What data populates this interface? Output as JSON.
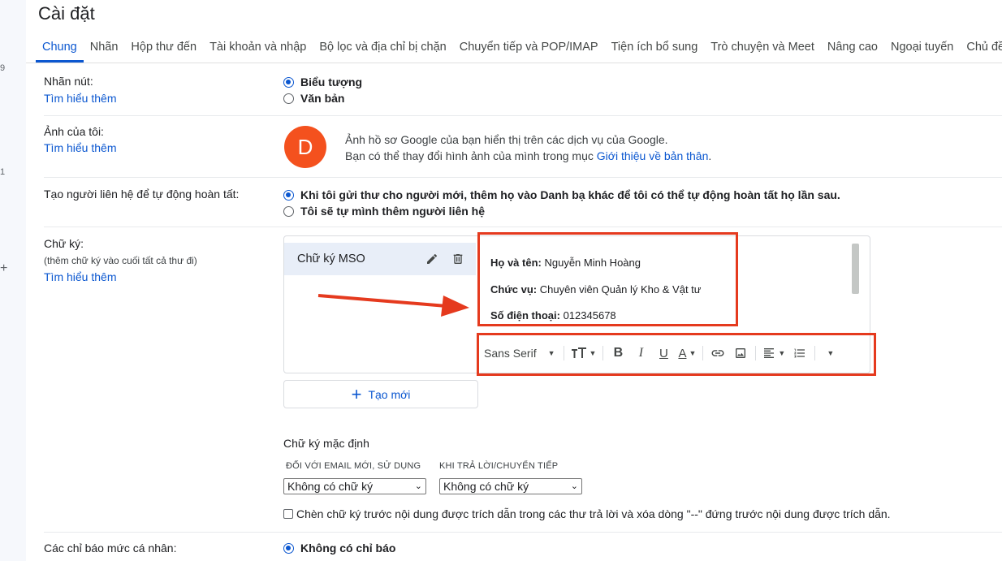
{
  "left_rail": {
    "marks": [
      "9",
      "1",
      "+"
    ]
  },
  "title": "Cài đặt",
  "tabs": [
    {
      "label": "Chung",
      "active": true
    },
    {
      "label": "Nhãn"
    },
    {
      "label": "Hộp thư đến"
    },
    {
      "label": "Tài khoản và nhập"
    },
    {
      "label": "Bộ lọc và địa chỉ bị chặn"
    },
    {
      "label": "Chuyển tiếp và POP/IMAP"
    },
    {
      "label": "Tiện ích bổ sung"
    },
    {
      "label": "Trò chuyện và Meet"
    },
    {
      "label": "Nâng cao"
    },
    {
      "label": "Ngoại tuyến"
    },
    {
      "label": "Chủ đề"
    }
  ],
  "learn_more": "Tìm hiểu thêm",
  "button_labels": {
    "label": "Nhãn nút:",
    "opt_icon": "Biểu tượng",
    "opt_text": "Văn bản"
  },
  "my_photo": {
    "label": "Ảnh của tôi:",
    "avatar_letter": "D",
    "line1": "Ảnh hồ sơ Google của bạn hiển thị trên các dịch vụ của Google.",
    "line2": "Bạn có thể thay đổi hình ảnh của mình trong mục",
    "link": "Giới thiệu về bản thân",
    "dot": "."
  },
  "contacts": {
    "label": "Tạo người liên hệ để tự động hoàn tất:",
    "opt1": "Khi tôi gửi thư cho người mới, thêm họ vào Danh bạ khác để tôi có thể tự động hoàn tất họ lần sau.",
    "opt2": "Tôi sẽ tự mình thêm người liên hệ"
  },
  "signature": {
    "label": "Chữ ký:",
    "sublabel": "(thêm chữ ký vào cuối tất cả thư đi)",
    "item_name": "Chữ ký MSO",
    "lines": [
      {
        "key": "Họ và tên:",
        "value": "Nguyễn Minh Hoàng"
      },
      {
        "key": "Chức vụ:",
        "value": "Chuyên viên Quản lý Kho & Vật tư"
      },
      {
        "key": "Số điện thoại:",
        "value": "012345678"
      }
    ],
    "font": "Sans Serif",
    "new_button": "Tạo mới",
    "default_title": "Chữ ký mặc định",
    "for_new_caption": "ĐỐI VỚI EMAIL MỚI, SỬ DỤNG",
    "for_reply_caption": "KHI TRẢ LỜI/CHUYỂN TIẾP",
    "for_new_value": "Không có chữ ký",
    "for_reply_value": "Không có chữ ký",
    "insert_before": "Chèn chữ ký trước nội dung được trích dẫn trong các thư trả lời và xóa dòng \"--\" đứng trước nội dung được trích dẫn."
  },
  "personal_indicators": {
    "label": "Các chỉ báo mức cá nhân:",
    "opt1": "Không có chỉ báo"
  },
  "colors": {
    "accent": "#0b57d0",
    "highlight": "#e53a1e",
    "avatar": "#f4511e"
  }
}
